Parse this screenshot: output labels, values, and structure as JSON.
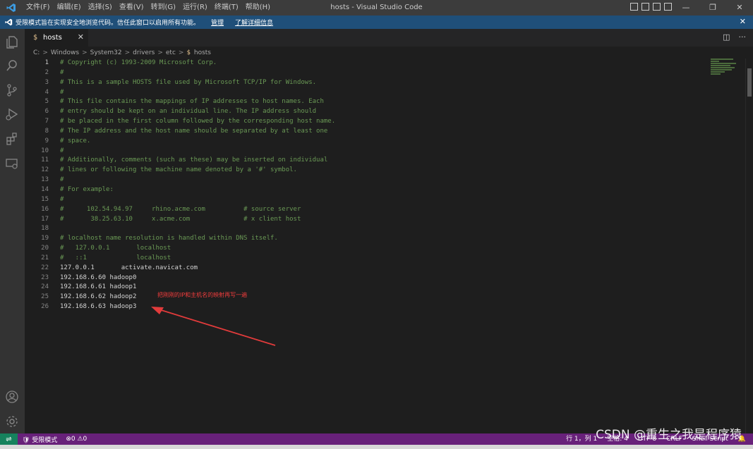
{
  "titlebar": {
    "menu": [
      "文件(F)",
      "编辑(E)",
      "选择(S)",
      "查看(V)",
      "转到(G)",
      "运行(R)",
      "终端(T)",
      "帮助(H)"
    ],
    "window_title": "hosts - Visual Studio Code",
    "min": "—",
    "max": "❐",
    "close": "✕"
  },
  "banner": {
    "text": "受限模式旨在实现安全地浏览代码。信任此窗口以启用所有功能。",
    "manage": "管理",
    "learn_more": "了解详细信息",
    "close": "✕"
  },
  "tab": {
    "icon_glyph": "$",
    "name": "hosts",
    "close": "✕"
  },
  "editor_actions": {
    "split": "◫",
    "more": "···"
  },
  "breadcrumb": {
    "parts": [
      "C:",
      "Windows",
      "System32",
      "drivers",
      "etc"
    ],
    "file_icon": "$",
    "file": "hosts",
    "sep": ">"
  },
  "gutter": [
    "1",
    "2",
    "3",
    "4",
    "5",
    "6",
    "7",
    "8",
    "9",
    "10",
    "11",
    "12",
    "13",
    "14",
    "15",
    "16",
    "17",
    "18",
    "19",
    "20",
    "21",
    "22",
    "23",
    "24",
    "25",
    "26"
  ],
  "code_lines": [
    "# Copyright (c) 1993-2009 Microsoft Corp.",
    "#",
    "# This is a sample HOSTS file used by Microsoft TCP/IP for Windows.",
    "#",
    "# This file contains the mappings of IP addresses to host names. Each",
    "# entry should be kept on an individual line. The IP address should",
    "# be placed in the first column followed by the corresponding host name.",
    "# The IP address and the host name should be separated by at least one",
    "# space.",
    "#",
    "# Additionally, comments (such as these) may be inserted on individual",
    "# lines or following the machine name denoted by a '#' symbol.",
    "#",
    "# For example:",
    "#",
    "#      102.54.94.97     rhino.acme.com          # source server",
    "#       38.25.63.10     x.acme.com              # x client host",
    "",
    "# localhost name resolution is handled within DNS itself.",
    "#   127.0.0.1       localhost",
    "#   ::1             localhost",
    "127.0.0.1       activate.navicat.com",
    "192.168.6.60 hadoop0",
    "192.168.6.61 hadoop1",
    "192.168.6.62 hadoop2",
    "192.168.6.63 hadoop3"
  ],
  "annotation": "把刚刚的IP和主机名的映射再写一遍",
  "statusbar": {
    "remote_icon": "⇌",
    "restricted": "受限模式",
    "errors": "0",
    "warnings": "0",
    "position": "行 1，列 1",
    "spaces": "空格: 4",
    "encoding": "UTF-8",
    "eol": "CRLF",
    "language": "Shell Script"
  },
  "watermark": "CSDN @重生之我是程序猿",
  "colors": {
    "titlebar": "#3c3c3c",
    "banner": "#1f4f79",
    "activitybar": "#333333",
    "editor_bg": "#1e1e1e",
    "statusbar": "#68217a",
    "comment": "#6a9955",
    "annotation": "#f03c3c"
  }
}
